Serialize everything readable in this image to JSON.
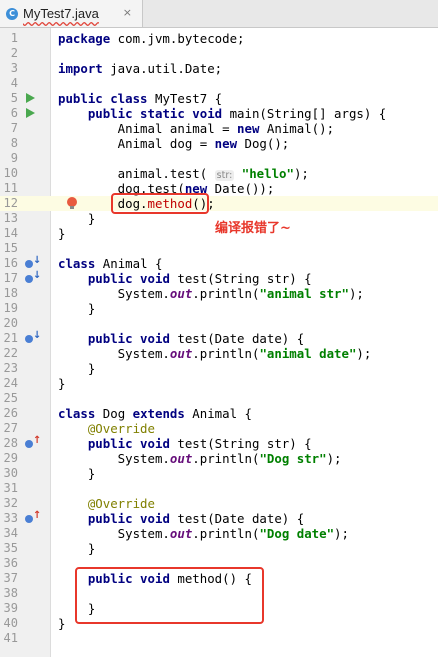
{
  "tab": {
    "label": "MyTest7.java",
    "icon": "java-class-icon",
    "close": "×"
  },
  "hint": "str:",
  "error_note": "编译报错了~",
  "colors": {
    "error_red": "#e8372b",
    "keyword": "#000080",
    "string": "#008000",
    "annotation": "#808000"
  },
  "lines": [
    {
      "n": "1",
      "code": "<span class=\"kw\">package</span> com.jvm.bytecode;"
    },
    {
      "n": "2",
      "code": ""
    },
    {
      "n": "3",
      "code": "<span class=\"kw\">import</span> java.util.Date;"
    },
    {
      "n": "4",
      "code": ""
    },
    {
      "n": "5",
      "code": "<span class=\"kw\">public class</span> MyTest7 {",
      "gutter": "run"
    },
    {
      "n": "6",
      "code": "    <span class=\"kw\">public static void</span> main(String[] args) {",
      "gutter": "run"
    },
    {
      "n": "7",
      "code": "        Animal animal = <span class=\"kw\">new</span> Animal();"
    },
    {
      "n": "8",
      "code": "        Animal dog = <span class=\"kw\">new</span> Dog();"
    },
    {
      "n": "9",
      "code": ""
    },
    {
      "n": "10",
      "code": "        animal.test( <span class=\"hint\">str:</span> <span class=\"str\">\"hello\"</span>);"
    },
    {
      "n": "11",
      "code": "        dog.test(<span class=\"kw\">new</span> Date());"
    },
    {
      "n": "12",
      "code": "        dog.<span class=\"meth\">method</span>();",
      "current": true,
      "gutter": "bulb"
    },
    {
      "n": "13",
      "code": "    }"
    },
    {
      "n": "14",
      "code": "}"
    },
    {
      "n": "15",
      "code": ""
    },
    {
      "n": "16",
      "code": "<span class=\"kw\">class</span> Animal {",
      "gutter": "impl"
    },
    {
      "n": "17",
      "code": "    <span class=\"kw\">public void</span> test(String str) {",
      "gutter": "impl"
    },
    {
      "n": "18",
      "code": "        System.<span class=\"fld\">out</span>.println(<span class=\"str\">\"animal str\"</span>);"
    },
    {
      "n": "19",
      "code": "    }"
    },
    {
      "n": "20",
      "code": ""
    },
    {
      "n": "21",
      "code": "    <span class=\"kw\">public void</span> test(Date date) {",
      "gutter": "impl"
    },
    {
      "n": "22",
      "code": "        System.<span class=\"fld\">out</span>.println(<span class=\"str\">\"animal date\"</span>);"
    },
    {
      "n": "23",
      "code": "    }"
    },
    {
      "n": "24",
      "code": "}"
    },
    {
      "n": "25",
      "code": ""
    },
    {
      "n": "26",
      "code": "<span class=\"kw\">class</span> Dog <span class=\"kw\">extends</span> Animal {"
    },
    {
      "n": "27",
      "code": "    <span class=\"ann\">@Override</span>"
    },
    {
      "n": "28",
      "code": "    <span class=\"kw\">public void</span> test(String str) {",
      "gutter": "override"
    },
    {
      "n": "29",
      "code": "        System.<span class=\"fld\">out</span>.println(<span class=\"str\">\"Dog str\"</span>);"
    },
    {
      "n": "30",
      "code": "    }"
    },
    {
      "n": "31",
      "code": ""
    },
    {
      "n": "32",
      "code": "    <span class=\"ann\">@Override</span>"
    },
    {
      "n": "33",
      "code": "    <span class=\"kw\">public void</span> test(Date date) {",
      "gutter": "override"
    },
    {
      "n": "34",
      "code": "        System.<span class=\"fld\">out</span>.println(<span class=\"str\">\"Dog date\"</span>);"
    },
    {
      "n": "35",
      "code": "    }"
    },
    {
      "n": "36",
      "code": ""
    },
    {
      "n": "37",
      "code": "    <span class=\"kw\">public void</span> method() {"
    },
    {
      "n": "38",
      "code": ""
    },
    {
      "n": "39",
      "code": "    }"
    },
    {
      "n": "40",
      "code": "}"
    },
    {
      "n": "41",
      "code": ""
    }
  ]
}
